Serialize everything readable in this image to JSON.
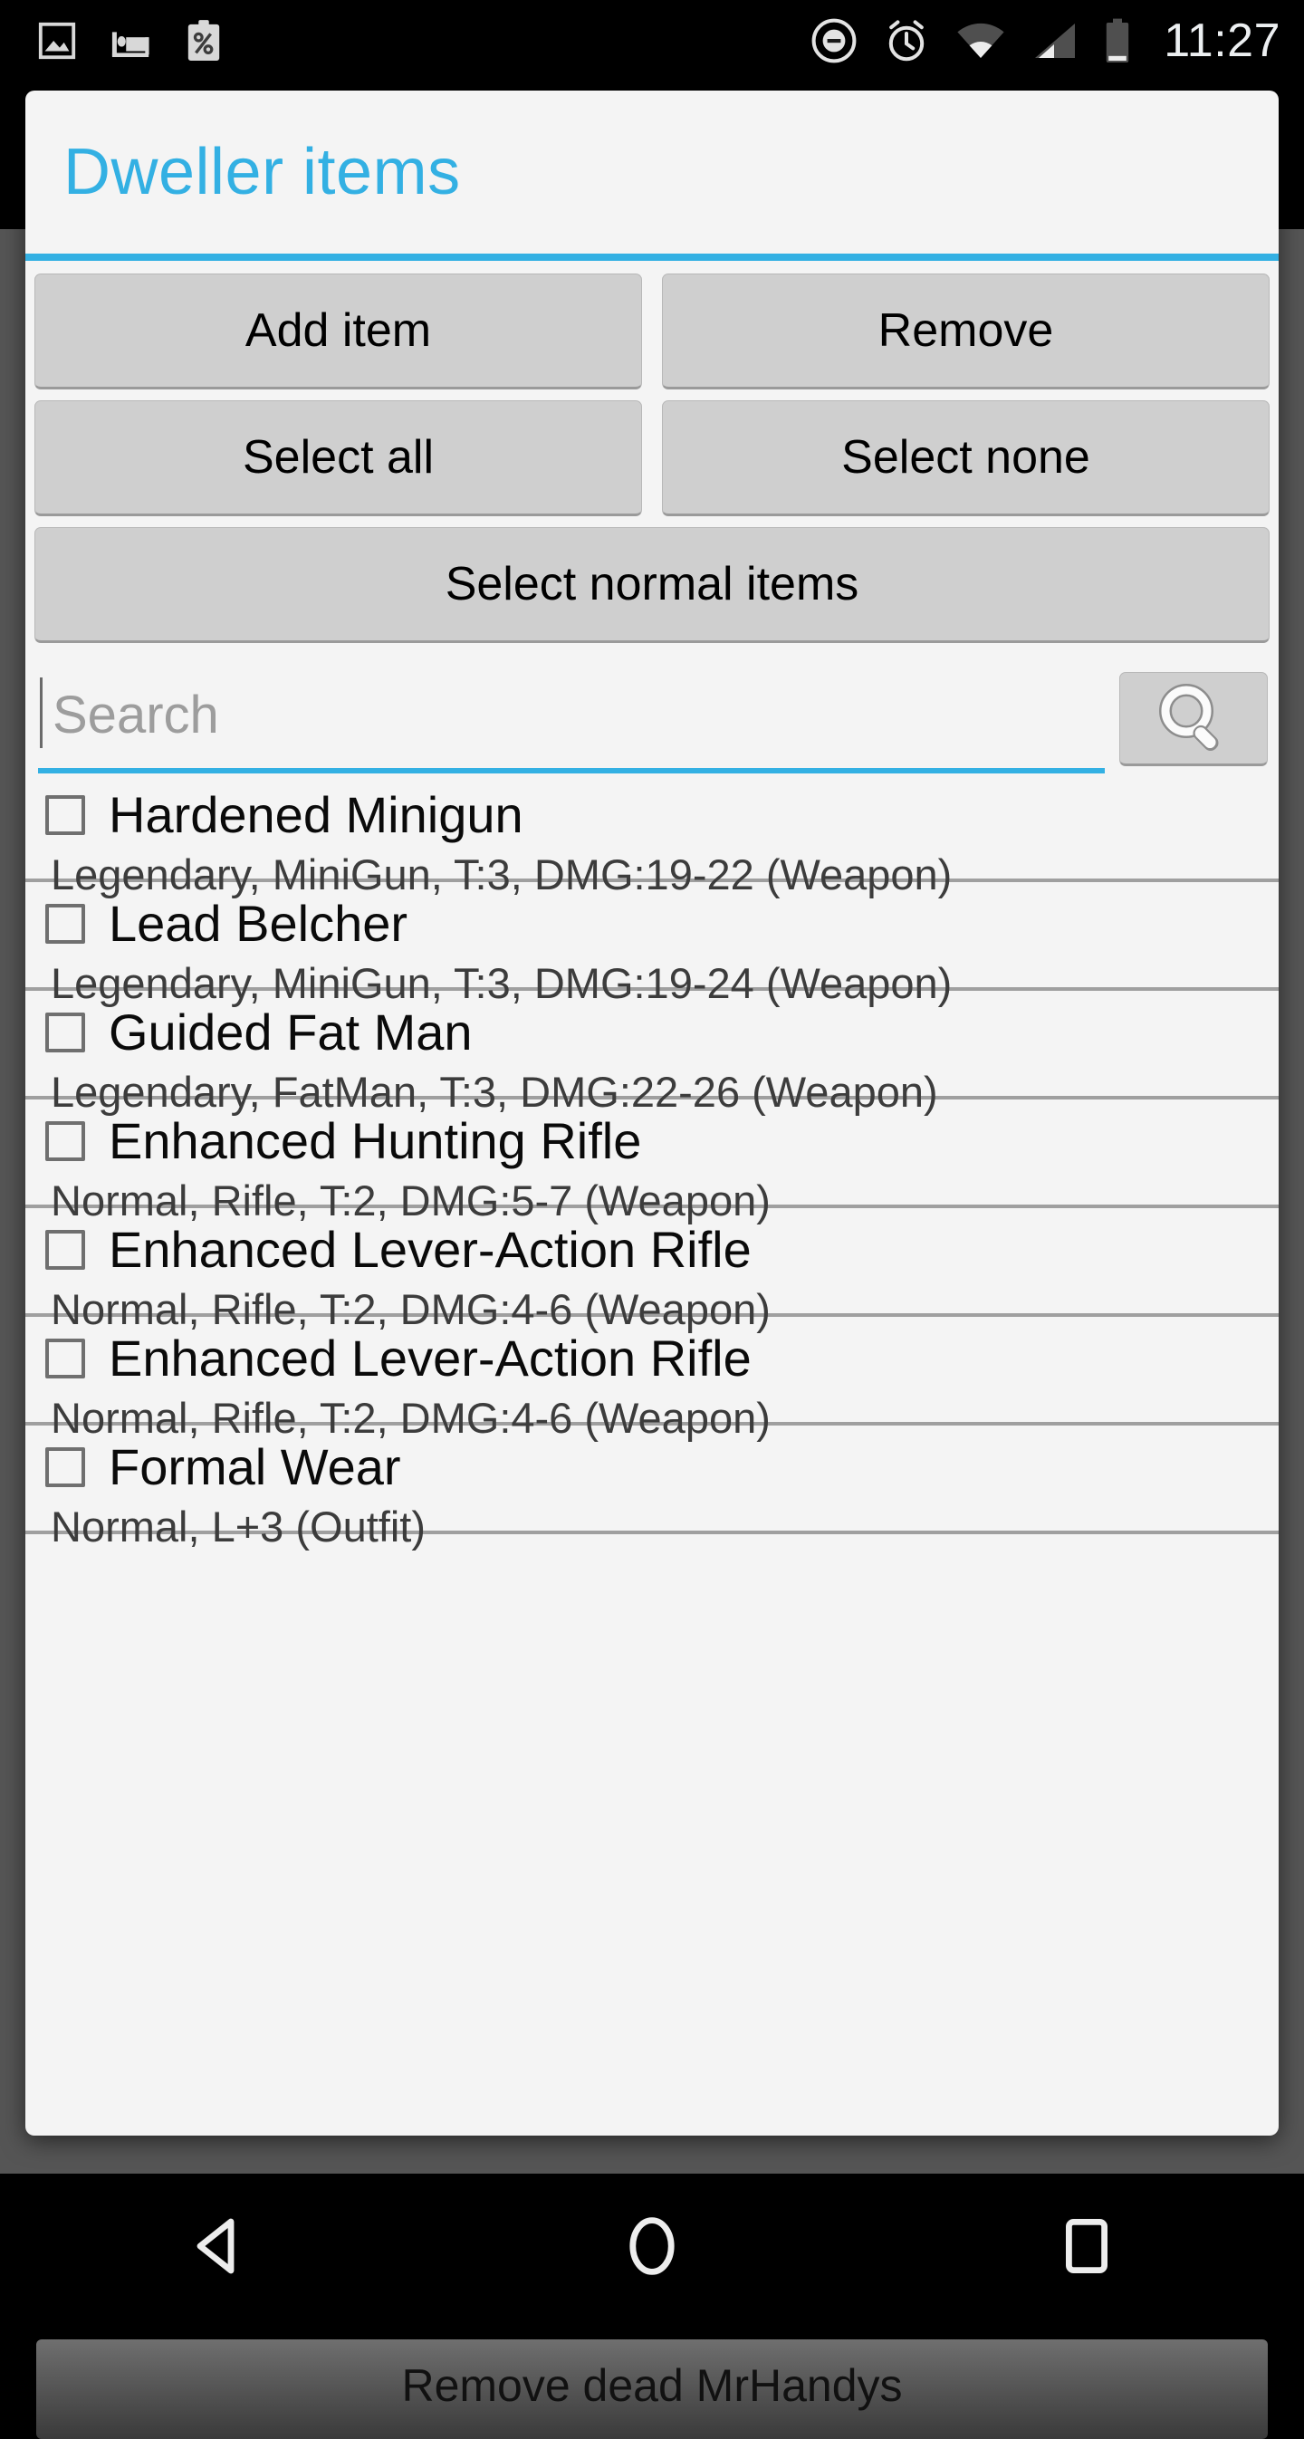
{
  "statusbar": {
    "icons_left": [
      "image-icon",
      "bed-icon",
      "clipboard-percent-icon"
    ],
    "icons_right": [
      "do-not-disturb-icon",
      "alarm-icon",
      "wifi-icon",
      "cellular-signal-icon",
      "battery-icon"
    ],
    "time": "11:27"
  },
  "dialog": {
    "title": "Dweller items",
    "accent_color": "#33b0e3",
    "buttons": [
      [
        {
          "label": "Add item",
          "name": "add-item-button"
        },
        {
          "label": "Remove",
          "name": "remove-button"
        }
      ],
      [
        {
          "label": "Select all",
          "name": "select-all-button"
        },
        {
          "label": "Select none",
          "name": "select-none-button"
        }
      ],
      [
        {
          "label": "Select normal items",
          "name": "select-normal-items-button"
        }
      ]
    ],
    "search": {
      "placeholder": "Search",
      "value": "",
      "button_icon": "magnifier-icon"
    },
    "items": [
      {
        "name": "Hardened Minigun",
        "details": "Legendary, MiniGun, T:3, DMG:19-22 (Weapon)",
        "checked": false
      },
      {
        "name": "Lead Belcher",
        "details": "Legendary, MiniGun, T:3, DMG:19-24 (Weapon)",
        "checked": false
      },
      {
        "name": "Guided Fat Man",
        "details": "Legendary, FatMan, T:3, DMG:22-26 (Weapon)",
        "checked": false
      },
      {
        "name": "Enhanced Hunting Rifle",
        "details": "Normal, Rifle, T:2, DMG:5-7 (Weapon)",
        "checked": false
      },
      {
        "name": "Enhanced Lever-Action Rifle",
        "details": "Normal, Rifle, T:2, DMG:4-6 (Weapon)",
        "checked": false
      },
      {
        "name": "Enhanced Lever-Action Rifle",
        "details": "Normal, Rifle, T:2, DMG:4-6 (Weapon)",
        "checked": false
      },
      {
        "name": "Formal Wear",
        "details": "Normal, L+3 (Outfit)",
        "checked": false
      }
    ]
  },
  "background": {
    "button_label": "Remove dead MrHandys"
  },
  "navbar": {
    "back": "back-triangle-icon",
    "home": "home-circle-icon",
    "recents": "recents-square-icon"
  }
}
